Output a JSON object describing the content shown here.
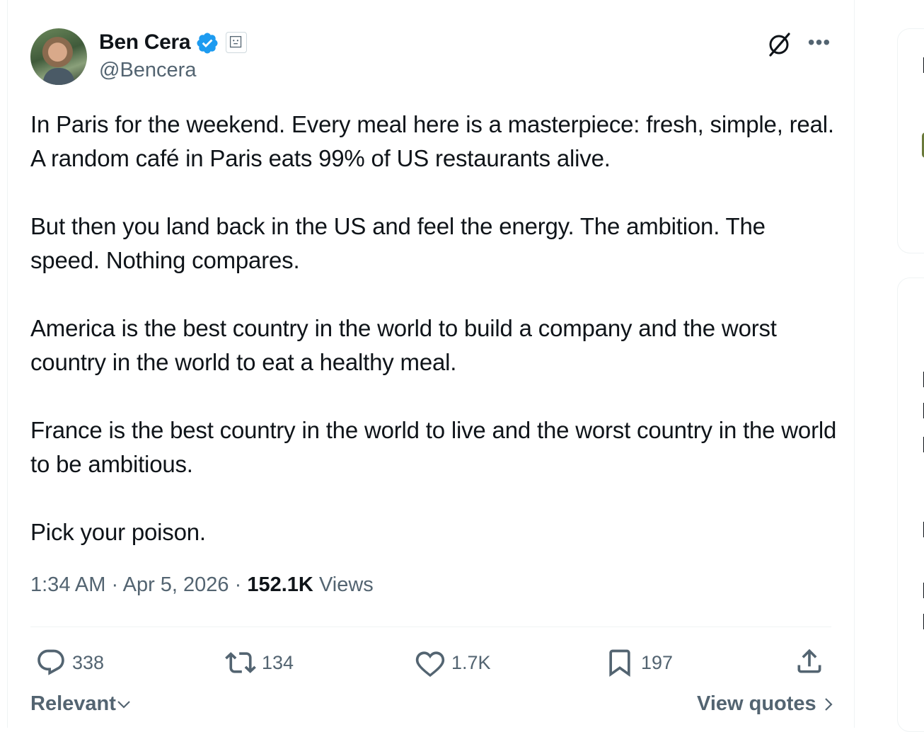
{
  "author": {
    "display_name": "Ben Cera",
    "handle": "@Bencera"
  },
  "tweet": {
    "paragraphs": [
      "In Paris for the weekend. Every meal here is a masterpiece: fresh, simple, real. A random café in Paris eats 99% of US restaurants alive.",
      "But then you land back in the US and feel the energy. The ambition. The speed. Nothing compares.",
      "America is the best country in the world to build a company and the worst country in the world to eat a healthy meal.",
      "France is the best country in the world to live and the worst country in the world to be ambitious.",
      "Pick your poison."
    ],
    "time": "1:34 AM",
    "separator": "·",
    "date": "Apr 5, 2026",
    "views_count": "152.1K",
    "views_label": "Views"
  },
  "actions": {
    "replies": "338",
    "reposts": "134",
    "likes": "1.7K",
    "bookmarks": "197"
  },
  "footer": {
    "sort_label": "Relevant",
    "view_quotes_label": "View quotes"
  },
  "colors": {
    "verified_blue": "#1d9bf0",
    "secondary_text": "#536471",
    "primary_text": "#0f1419",
    "border": "#eff3f4"
  }
}
